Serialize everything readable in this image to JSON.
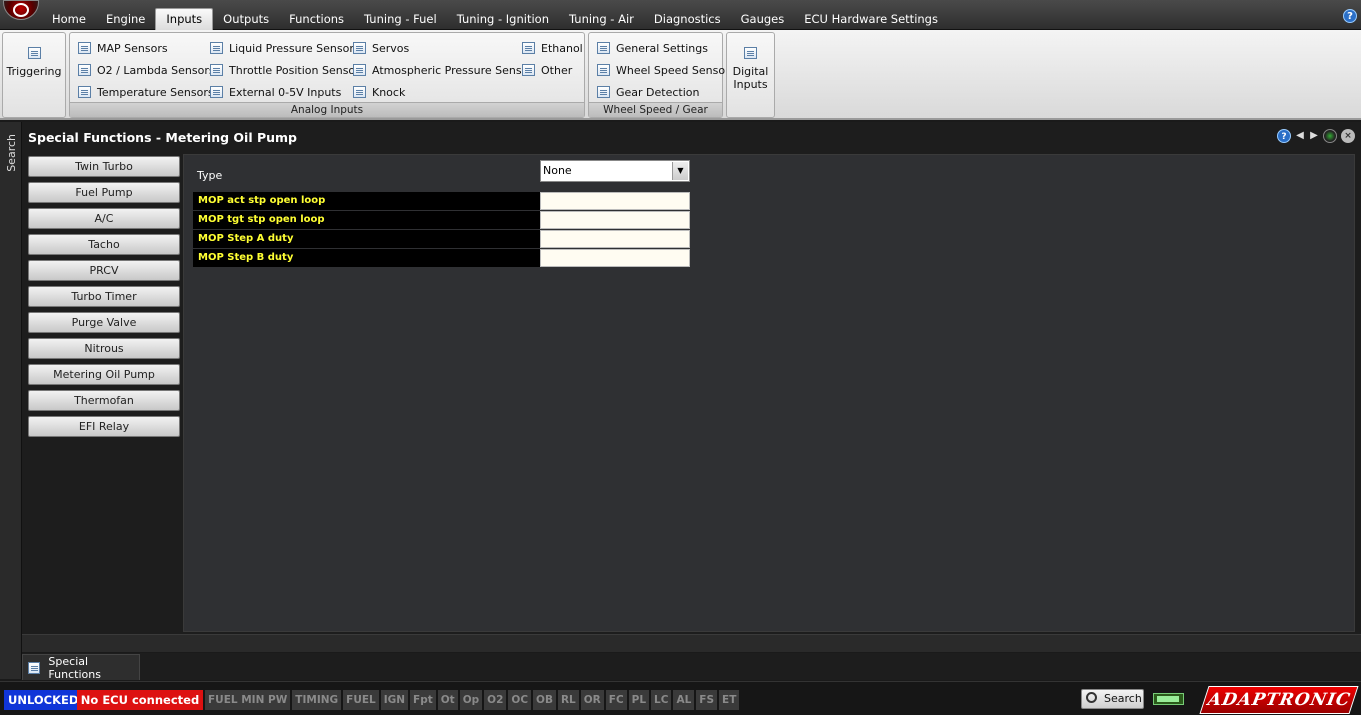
{
  "menu": {
    "tabs": [
      "Home",
      "Engine",
      "Inputs",
      "Outputs",
      "Functions",
      "Tuning - Fuel",
      "Tuning - Ignition",
      "Tuning - Air",
      "Diagnostics",
      "Gauges",
      "ECU Hardware Settings"
    ],
    "active_tab": "Inputs",
    "help_icon": "help-icon"
  },
  "ribbon": {
    "triggering": "Triggering",
    "analog_inputs": {
      "label": "Analog Inputs",
      "col1": [
        "MAP Sensors",
        "O2 / Lambda Sensors",
        "Temperature Sensors"
      ],
      "col2": [
        "Liquid Pressure Sensors",
        "Throttle Position Sensor",
        "External 0-5V Inputs"
      ],
      "col3": [
        "Servos",
        "Atmospheric Pressure Sensor",
        "Knock"
      ],
      "col4": [
        "Ethanol",
        "Other"
      ]
    },
    "wheel_speed": {
      "label": "Wheel Speed / Gear",
      "items": [
        "General Settings",
        "Wheel Speed Sensor",
        "Gear Detection"
      ]
    },
    "digital_inputs_line1": "Digital",
    "digital_inputs_line2": "Inputs"
  },
  "side": {
    "search_label": "Search"
  },
  "panel": {
    "title": "Special Functions - Metering Oil Pump",
    "functions": [
      "Twin Turbo",
      "Fuel Pump",
      "A/C",
      "Tacho",
      "PRCV",
      "Turbo Timer",
      "Purge Valve",
      "Nitrous",
      "Metering Oil Pump",
      "Thermofan",
      "EFI Relay"
    ],
    "type_label": "Type",
    "type_value": "None",
    "params": [
      {
        "label": "MOP act stp open loop",
        "value": ""
      },
      {
        "label": "MOP tgt stp open loop",
        "value": ""
      },
      {
        "label": "MOP Step A duty",
        "value": ""
      },
      {
        "label": "MOP Step B duty",
        "value": ""
      }
    ]
  },
  "bottom_tab": {
    "label": "Special Functions"
  },
  "status": {
    "unlocked": "UNLOCKED",
    "ecu": "No ECU connected",
    "flags": [
      "FUEL MIN PW",
      "TIMING",
      "FUEL",
      "IGN",
      "Fpt",
      "Ot",
      "Op",
      "O2",
      "OC",
      "OB",
      "RL",
      "OR",
      "FC",
      "PL",
      "LC",
      "AL",
      "FS",
      "ET"
    ],
    "search": "Search",
    "logo": "ADAPTRONIC",
    "colors": {
      "unlocked": "#1035d8",
      "ecu": "#dd1111",
      "flag_text": "#8a8a8a"
    }
  }
}
